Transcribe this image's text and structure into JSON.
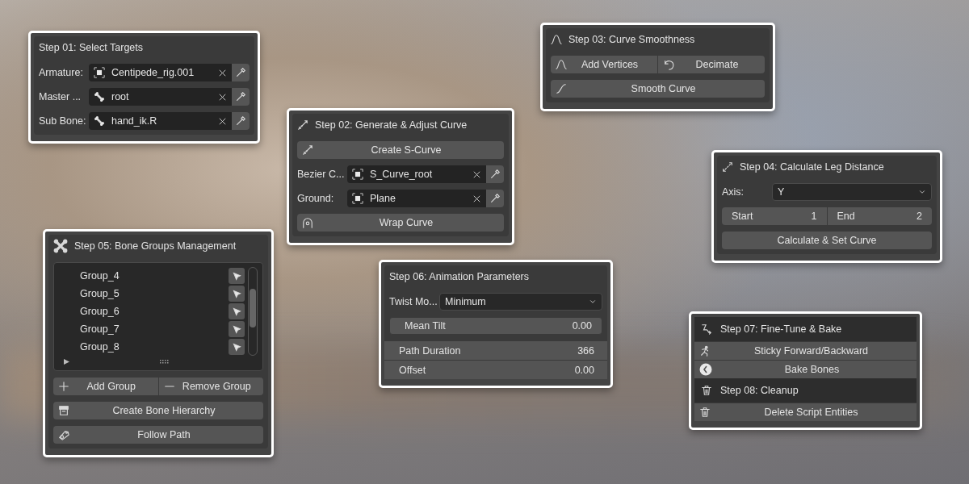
{
  "panels": [
    {
      "rows": [
        {
          "kind": "header",
          "label": "Step 01: Select Targets"
        },
        {
          "kind": "field",
          "label": "Armature:",
          "value": "Centipede_rig.001"
        },
        {
          "kind": "field",
          "label": "Master ...",
          "value": "root"
        },
        {
          "kind": "field",
          "label": "Sub Bone:",
          "value": "hand_ik.R"
        }
      ]
    },
    {
      "rows": [
        {
          "kind": "header",
          "label": "Step 02: Generate & Adjust Curve"
        },
        {
          "kind": "button",
          "label": "Create S-Curve"
        },
        {
          "kind": "field",
          "label": "Bezier C...",
          "value": "S_Curve_root"
        },
        {
          "kind": "field",
          "label": "Ground:",
          "value": "Plane"
        },
        {
          "kind": "button",
          "label": "Wrap Curve"
        }
      ]
    },
    {
      "rows": [
        {
          "kind": "header",
          "label": "Step 03: Curve Smoothness"
        },
        {
          "kind": "pair",
          "items": [
            {
              "label": "Add Vertices"
            },
            {
              "label": "Decimate"
            }
          ]
        },
        {
          "kind": "button",
          "label": "Smooth Curve"
        }
      ]
    },
    {
      "rows": [
        {
          "kind": "header",
          "label": "Step 04: Calculate Leg Distance"
        },
        {
          "kind": "dropdown",
          "label": "Axis:",
          "value": "Y"
        },
        {
          "kind": "numbers",
          "items": [
            {
              "label": "Start",
              "value": "1"
            },
            {
              "label": "End",
              "value": "2"
            }
          ]
        },
        {
          "kind": "button",
          "label": "Calculate & Set Curve"
        }
      ]
    },
    {
      "rows": [
        {
          "kind": "header",
          "label": "Step 05: Bone Groups Management"
        },
        {
          "kind": "list",
          "items": [
            {
              "label": "Group_4"
            },
            {
              "label": "Group_5"
            },
            {
              "label": "Group_6"
            },
            {
              "label": "Group_7"
            },
            {
              "label": "Group_8"
            }
          ]
        },
        {
          "kind": "pair",
          "items": [
            {
              "label": "Add Group"
            },
            {
              "label": "Remove Group"
            }
          ]
        },
        {
          "kind": "button",
          "label": "Create Bone Hierarchy"
        },
        {
          "kind": "button",
          "label": "Follow Path"
        }
      ]
    },
    {
      "rows": [
        {
          "kind": "header",
          "label": "Step 06: Animation Parameters"
        },
        {
          "kind": "dropdown",
          "label": "Twist Mo...",
          "value": "Minimum"
        },
        {
          "kind": "number",
          "label": "Mean Tilt",
          "value": "0.00"
        },
        {
          "kind": "prop",
          "label": "Path Duration",
          "value": "366"
        },
        {
          "kind": "prop",
          "label": "Offset",
          "value": "0.00"
        }
      ]
    },
    {
      "rows": [
        {
          "kind": "bar",
          "label": "Step 07: Fine-Tune & Bake"
        },
        {
          "kind": "flat",
          "label": "Sticky Forward/Backward"
        },
        {
          "kind": "flat",
          "label": "Bake Bones"
        },
        {
          "kind": "bar",
          "label": "Step 08: Cleanup"
        },
        {
          "kind": "flat",
          "label": "Delete Script Entities"
        }
      ]
    }
  ]
}
